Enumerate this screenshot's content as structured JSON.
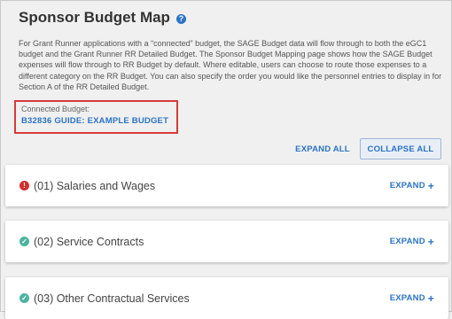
{
  "header": {
    "title": "Sponsor Budget Map",
    "help_icon": "?"
  },
  "description": "For Grant Runner applications with a “connected” budget, the SAGE Budget data will flow through to both the eGC1 budget and the Grant Runner RR Detailed Budget. The Sponsor Budget Mapping page shows how the SAGE Budget expenses will flow through to RR Budget by default. Where editable, users can choose to route those expenses to a different category on the RR Budget. You can also specify the order you would like the personnel entries to display in for Section A of the RR Detailed Budget.",
  "connected_budget": {
    "label": "Connected Budget:",
    "link": "B32836 GUIDE: EXAMPLE BUDGET"
  },
  "controls": {
    "expand_all": "EXPAND ALL",
    "collapse_all": "COLLAPSE ALL"
  },
  "sections": [
    {
      "title": "(01) Salaries and Wages",
      "status": "error",
      "status_glyph": "!",
      "action": "EXPAND",
      "action_icon": "+"
    },
    {
      "title": "(02) Service Contracts",
      "status": "ok",
      "status_glyph": "✓",
      "action": "EXPAND",
      "action_icon": "+"
    },
    {
      "title": "(03) Other Contractual Services",
      "status": "ok",
      "status_glyph": "✓",
      "action": "EXPAND",
      "action_icon": "+"
    }
  ],
  "colors": {
    "accent": "#2a73c8",
    "error": "#d32f2f",
    "ok": "#4bb4a0",
    "highlight_border": "#d93a3a"
  }
}
